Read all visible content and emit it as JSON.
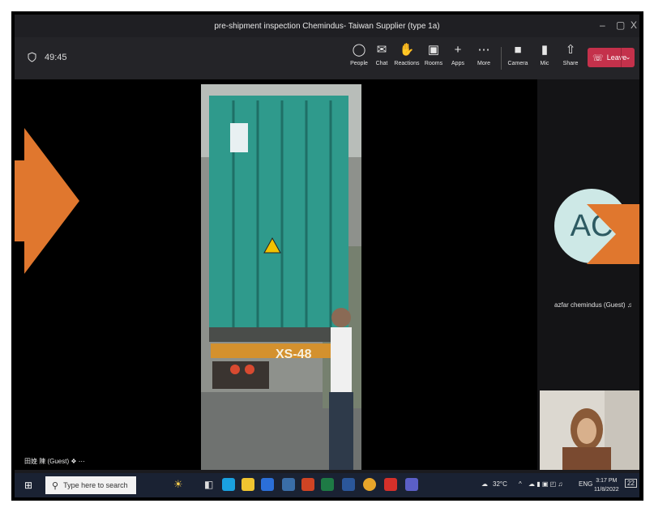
{
  "window": {
    "title": "pre-shipment inspection Chemindus- Taiwan Supplier (type 1a)",
    "controls": [
      "–",
      "▢",
      "X"
    ]
  },
  "toolbar": {
    "timer": "49:45",
    "buttons": [
      {
        "label": "People",
        "icon": "people-icon"
      },
      {
        "label": "Chat",
        "icon": "chat-icon"
      },
      {
        "label": "Reactions",
        "icon": "reactions-icon"
      },
      {
        "label": "Rooms",
        "icon": "rooms-icon"
      },
      {
        "label": "Apps",
        "icon": "apps-icon"
      },
      {
        "label": "More",
        "icon": "more-icon"
      },
      {
        "label": "Camera",
        "icon": "camera-icon"
      },
      {
        "label": "Mic",
        "icon": "mic-icon"
      },
      {
        "label": "Share",
        "icon": "share-icon"
      }
    ],
    "leave_label": "Leave"
  },
  "participants": {
    "avatar_initials": "AC",
    "avatar_name": "azfar chemindus (Guest)",
    "guest_label": "田娩 陳 (Guest)"
  },
  "video": {
    "container_code": "XS-48"
  },
  "taskbar": {
    "search_placeholder": "Type here to search",
    "weather": "32°C",
    "lang": "ENG",
    "time": "3:17 PM",
    "date": "11/8/2022",
    "notifications": "22"
  },
  "colors": {
    "accent_arrow": "#e0772e",
    "leave": "#c4314b",
    "container": "#2f9a8c"
  }
}
